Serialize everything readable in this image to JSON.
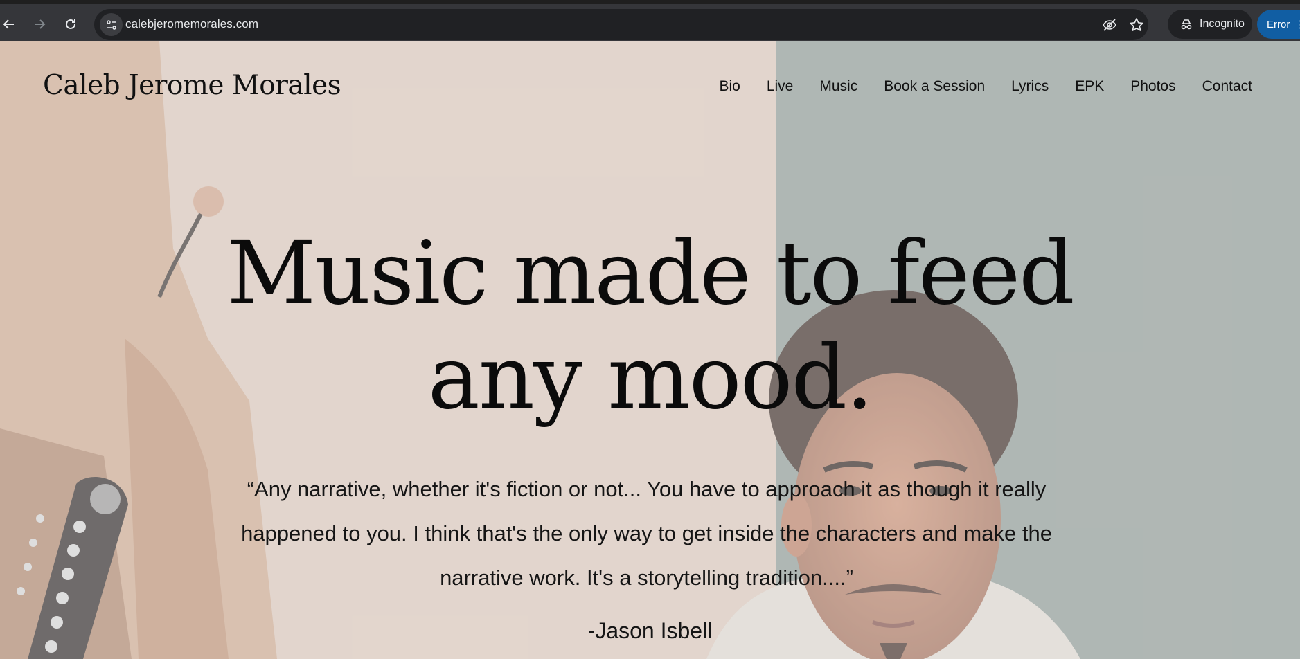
{
  "browser": {
    "url": "calebjeromemorales.com",
    "incognito_label": "Incognito",
    "error_label": "Error",
    "icons": [
      "back-icon",
      "forward-icon",
      "reload-icon",
      "site-info-icon",
      "eye-off-icon",
      "star-icon",
      "incognito-icon",
      "more-icon"
    ]
  },
  "site": {
    "title": "Caleb Jerome Morales",
    "nav": [
      {
        "label": "Bio"
      },
      {
        "label": "Live"
      },
      {
        "label": "Music"
      },
      {
        "label": "Book a Session"
      },
      {
        "label": "Lyrics"
      },
      {
        "label": "EPK"
      },
      {
        "label": "Photos"
      },
      {
        "label": "Contact"
      }
    ]
  },
  "hero": {
    "heading_line1": "Music made to feed",
    "heading_line2": "any mood.",
    "quote": "“Any narrative, whether it's fiction or not... You have to approach it as though it really happened to you. I think that's the only way to get inside the characters and make the narrative work. It's a storytelling tradition....”",
    "attribution": "-Jason Isbell"
  },
  "colors": {
    "chrome_bg": "#35363a",
    "omnibox_bg": "#202124",
    "error_pill": "#115ea3",
    "wall_left": "#d8c7bb",
    "wall_right": "#8d9794"
  }
}
